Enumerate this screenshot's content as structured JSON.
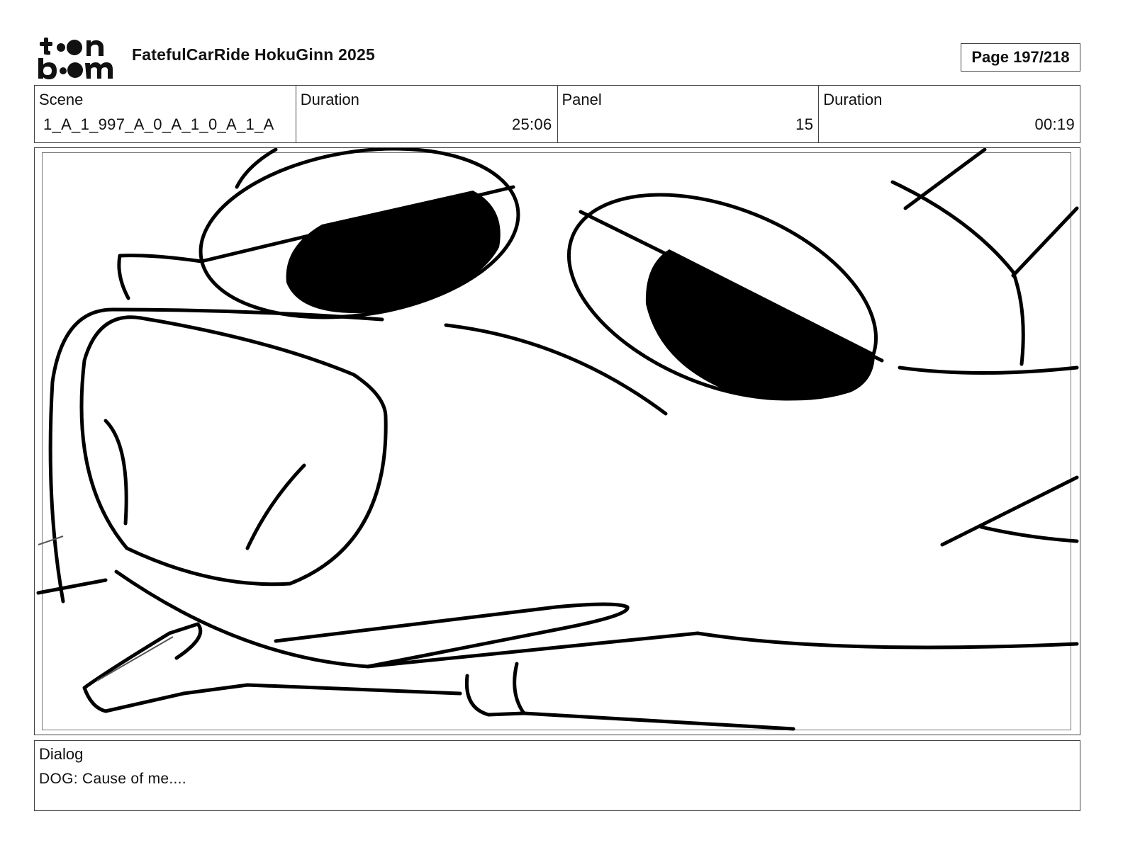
{
  "header": {
    "logo_text": "toon boom",
    "project_title": "FatefulCarRide HokuGinn 2025",
    "page_label": "Page 197/218"
  },
  "info": {
    "scene_label": "Scene",
    "scene_value": "1_A_1_997_A_0_A_1_0_A_1_A",
    "scene_duration_label": "Duration",
    "scene_duration_value": "25:06",
    "panel_label": "Panel",
    "panel_value": "15",
    "panel_duration_label": "Duration",
    "panel_duration_value": "00:19"
  },
  "panel": {
    "image_icon": "sketch-image-icon"
  },
  "dialog": {
    "label": "Dialog",
    "text": "DOG: Cause of me...."
  }
}
